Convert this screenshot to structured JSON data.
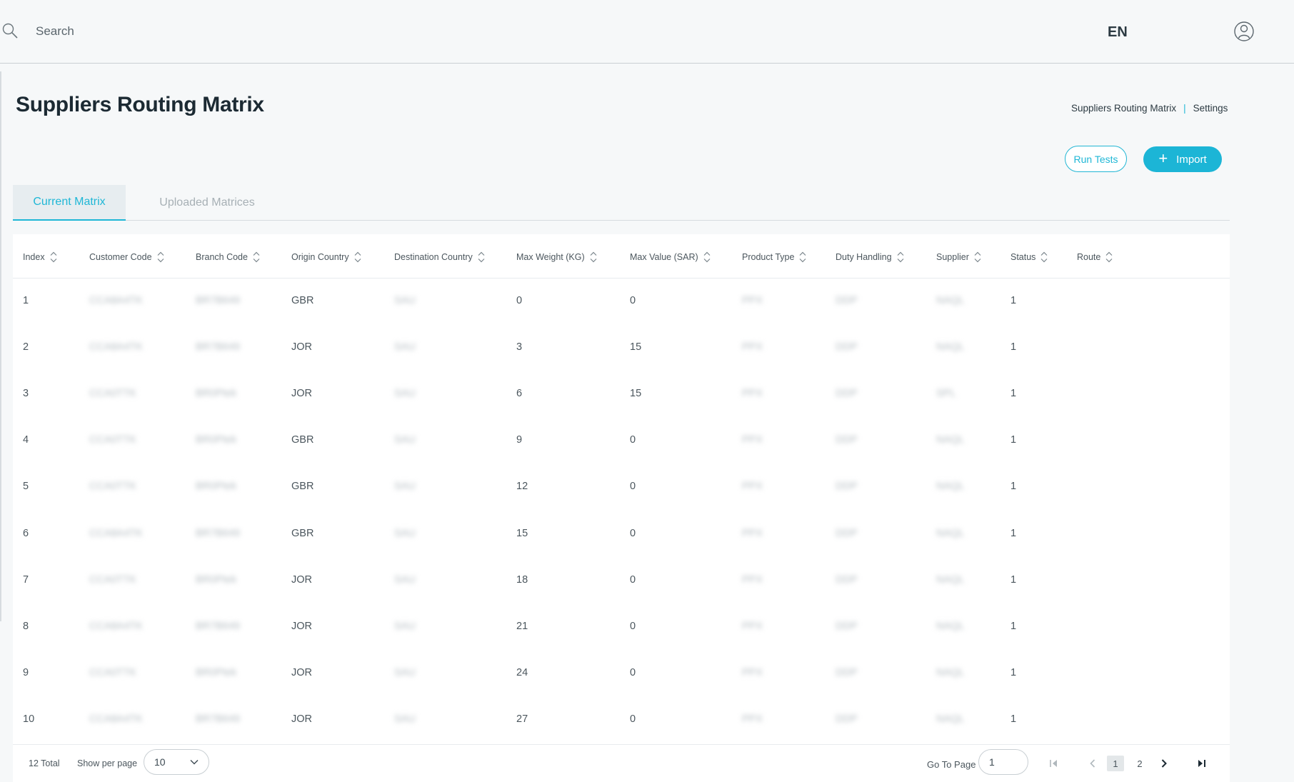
{
  "header": {
    "search_placeholder": "Search",
    "language": "EN"
  },
  "page": {
    "title": "Suppliers Routing Matrix",
    "breadcrumb": [
      "Suppliers Routing Matrix",
      "Settings"
    ],
    "run_tests_label": "Run Tests",
    "import_label": "Import"
  },
  "tabs": [
    {
      "label": "Current Matrix",
      "active": true
    },
    {
      "label": "Uploaded Matrices",
      "active": false
    }
  ],
  "table": {
    "columns": [
      "Index",
      "Customer Code",
      "Branch Code",
      "Origin Country",
      "Destination Country",
      "Max Weight (KG)",
      "Max Value (SAR)",
      "Product Type",
      "Duty Handling",
      "Supplier",
      "Status",
      "Route"
    ],
    "rows": [
      {
        "index": "1",
        "customer": "CCA8A4TK",
        "branch": "BR7B649",
        "origin": "GBR",
        "dest": "SAU",
        "weight": "0",
        "value": "0",
        "product": "PPX",
        "duty": "DDP",
        "supplier": "NAQL",
        "status": "1",
        "route": ""
      },
      {
        "index": "2",
        "customer": "CCA8A4TK",
        "branch": "BR7B649",
        "origin": "JOR",
        "dest": "SAU",
        "weight": "3",
        "value": "15",
        "product": "PPX",
        "duty": "DDP",
        "supplier": "NAQL",
        "status": "1",
        "route": ""
      },
      {
        "index": "3",
        "customer": "CCA0TTK",
        "branch": "BR0Ptek",
        "origin": "JOR",
        "dest": "SAU",
        "weight": "6",
        "value": "15",
        "product": "PPX",
        "duty": "DDP",
        "supplier": "SPL",
        "status": "1",
        "route": ""
      },
      {
        "index": "4",
        "customer": "CCA0TTK",
        "branch": "BR0Ptek",
        "origin": "GBR",
        "dest": "SAU",
        "weight": "9",
        "value": "0",
        "product": "PPX",
        "duty": "DDP",
        "supplier": "NAQL",
        "status": "1",
        "route": ""
      },
      {
        "index": "5",
        "customer": "CCA0TTK",
        "branch": "BR0Ptek",
        "origin": "GBR",
        "dest": "SAU",
        "weight": "12",
        "value": "0",
        "product": "PPX",
        "duty": "DDP",
        "supplier": "NAQL",
        "status": "1",
        "route": ""
      },
      {
        "index": "6",
        "customer": "CCA8A4TK",
        "branch": "BR7B649",
        "origin": "GBR",
        "dest": "SAU",
        "weight": "15",
        "value": "0",
        "product": "PPX",
        "duty": "DDP",
        "supplier": "NAQL",
        "status": "1",
        "route": ""
      },
      {
        "index": "7",
        "customer": "CCA0TTK",
        "branch": "BR0Ptek",
        "origin": "JOR",
        "dest": "SAU",
        "weight": "18",
        "value": "0",
        "product": "PPX",
        "duty": "DDP",
        "supplier": "NAQL",
        "status": "1",
        "route": ""
      },
      {
        "index": "8",
        "customer": "CCA8A4TK",
        "branch": "BR7B649",
        "origin": "JOR",
        "dest": "SAU",
        "weight": "21",
        "value": "0",
        "product": "PPX",
        "duty": "DDP",
        "supplier": "NAQL",
        "status": "1",
        "route": ""
      },
      {
        "index": "9",
        "customer": "CCA0TTK",
        "branch": "BR0Ptek",
        "origin": "JOR",
        "dest": "SAU",
        "weight": "24",
        "value": "0",
        "product": "PPX",
        "duty": "DDP",
        "supplier": "NAQL",
        "status": "1",
        "route": ""
      },
      {
        "index": "10",
        "customer": "CCA8A4TK",
        "branch": "BR7B649",
        "origin": "JOR",
        "dest": "SAU",
        "weight": "27",
        "value": "0",
        "product": "PPX",
        "duty": "DDP",
        "supplier": "NAQL",
        "status": "1",
        "route": ""
      }
    ]
  },
  "pagination": {
    "total": "12 Total",
    "per_page_label": "Show per page",
    "per_page_value": "10",
    "goto_label": "Go To Page",
    "goto_value": "1",
    "pages": [
      "1",
      "2"
    ],
    "current_page": "1"
  },
  "colors": {
    "accent": "#1cb5d6",
    "background": "#f6f8f9"
  },
  "icons": {
    "search": "search-icon",
    "user": "user-icon",
    "sort": "sort-icon",
    "plus": "plus-icon"
  }
}
